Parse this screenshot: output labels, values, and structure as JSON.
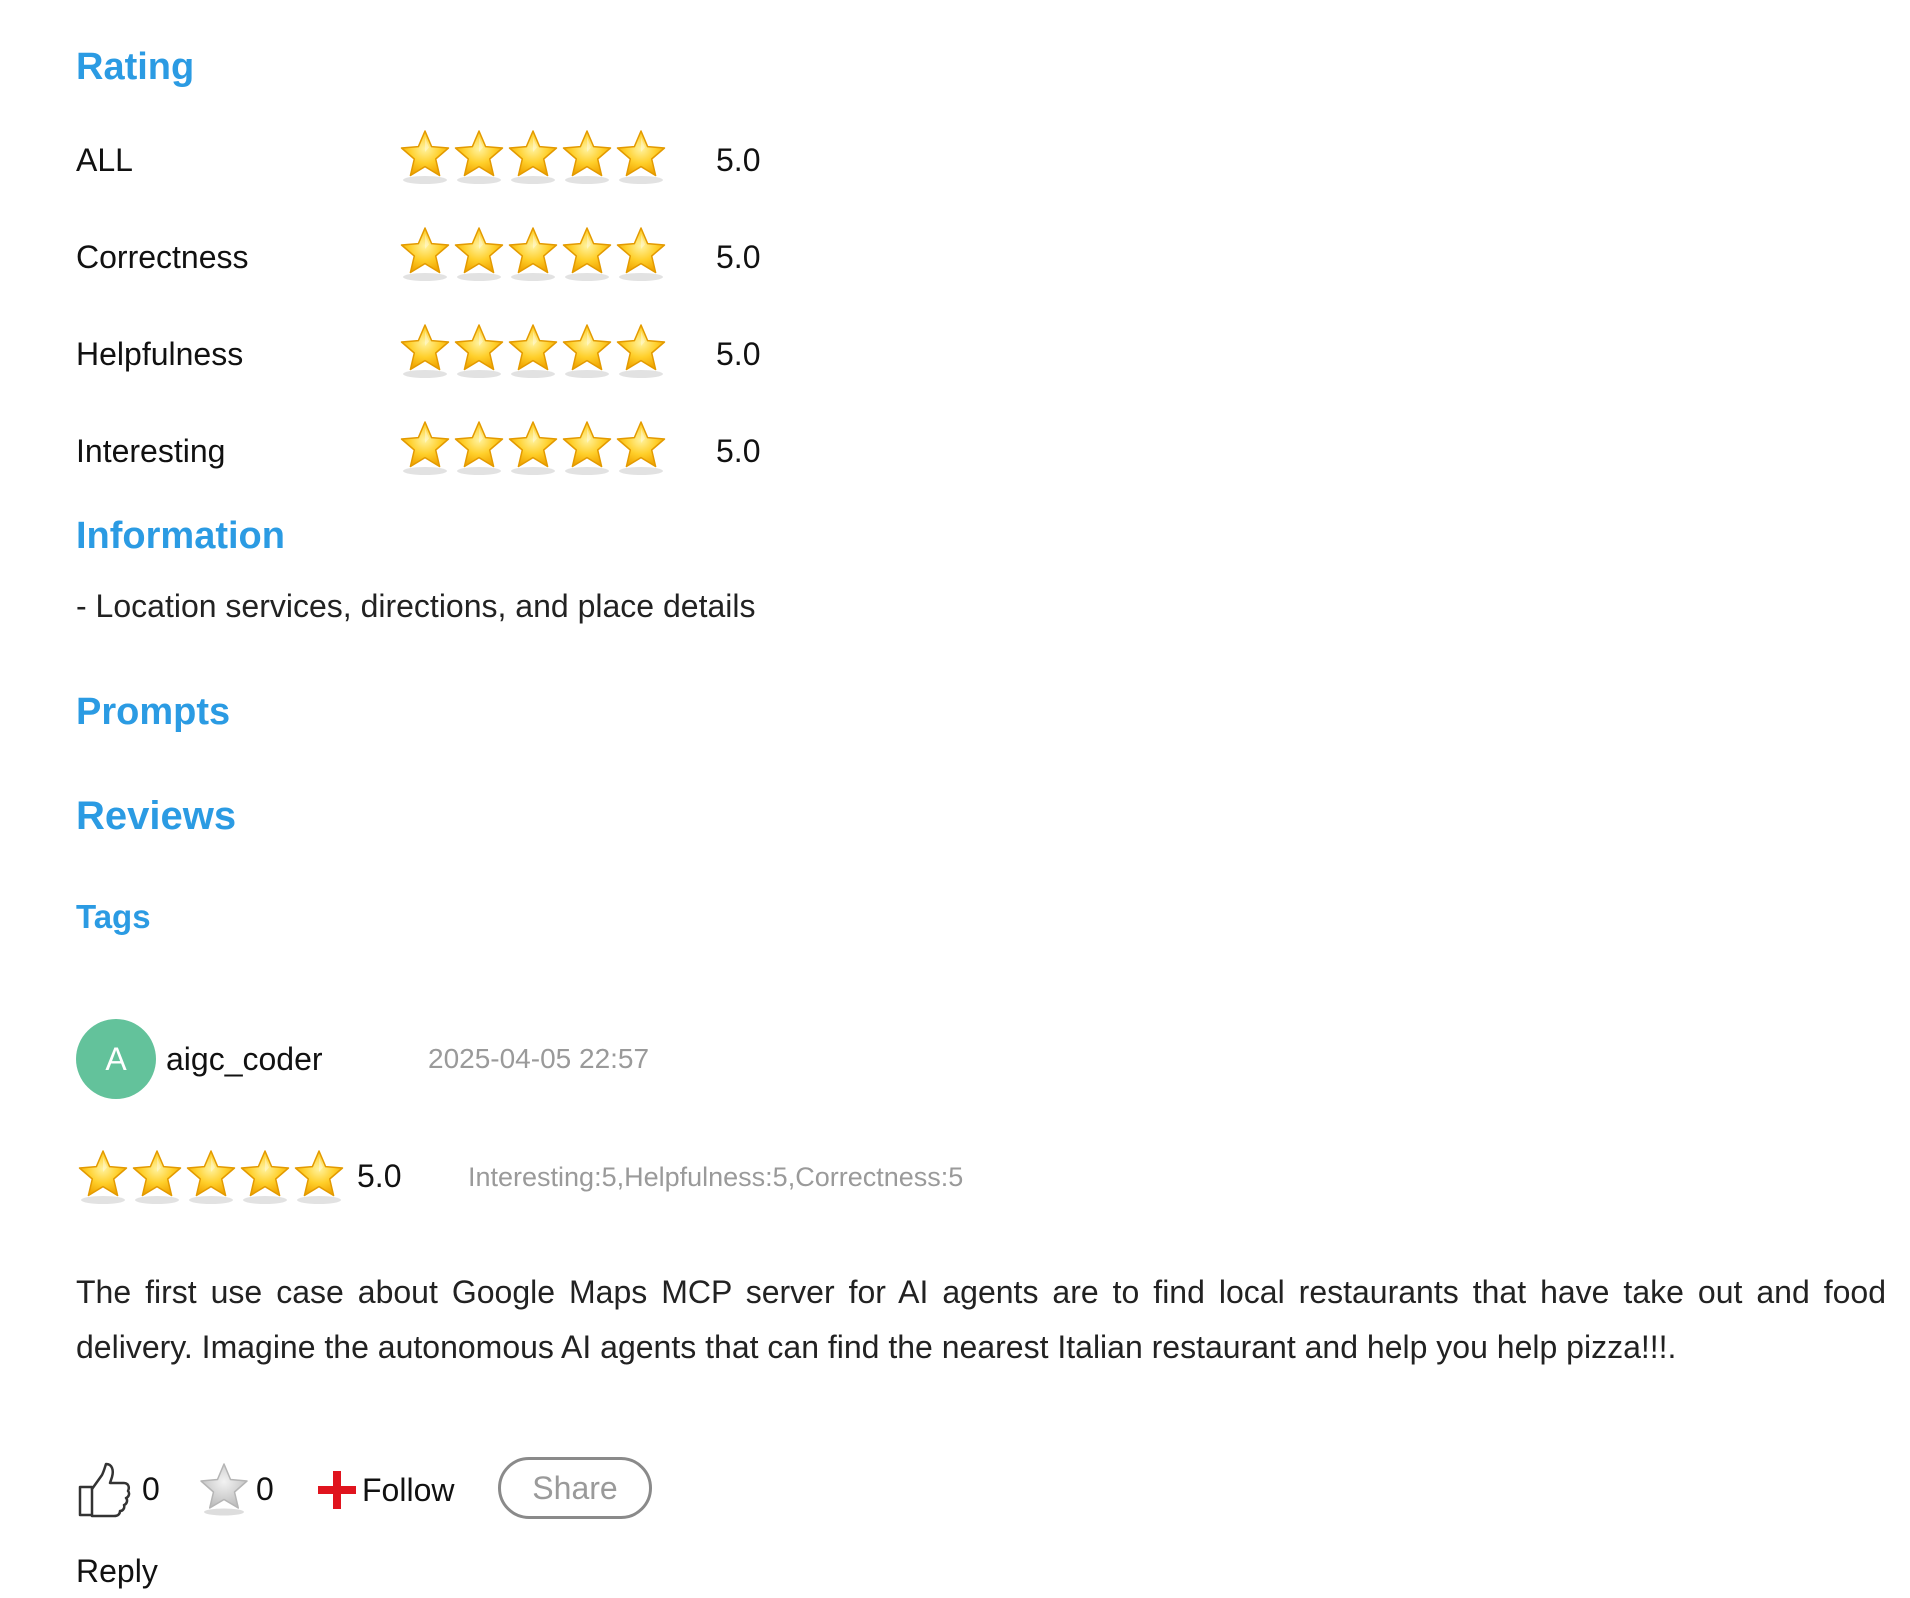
{
  "sections": {
    "rating": "Rating",
    "information": "Information",
    "prompts": "Prompts",
    "reviews": "Reviews",
    "tags": "Tags"
  },
  "ratings": [
    {
      "label": "ALL",
      "value": "5.0",
      "stars": 5
    },
    {
      "label": "Correctness",
      "value": "5.0",
      "stars": 5
    },
    {
      "label": "Helpfulness",
      "value": "5.0",
      "stars": 5
    },
    {
      "label": "Interesting",
      "value": "5.0",
      "stars": 5
    }
  ],
  "information": {
    "text": "- Location services, directions, and place details"
  },
  "review": {
    "avatar_letter": "A",
    "username": "aigc_coder",
    "date": "2025-04-05 22:57",
    "stars": 5,
    "score": "5.0",
    "sub_scores": "Interesting:5,Helpfulness:5,Correctness:5",
    "body": "The first use case about Google Maps MCP server for AI agents are to find local restaurants that have take out and food delivery. Imagine the autonomous AI agents that can find the nearest Italian restaurant and help you help pizza!!!.",
    "like_count": "0",
    "favorite_count": "0",
    "follow_label": "Follow",
    "share_label": "Share",
    "reply_label": "Reply"
  },
  "colors": {
    "heading": "#2b9be3",
    "avatar": "#63c29b",
    "star": "#ffc21a",
    "muted": "#9a9a9a",
    "follow_plus": "#e0141e"
  },
  "icons": {
    "star": "star-icon",
    "like": "thumbs-up-icon",
    "favorite": "star-outline-icon",
    "follow": "plus-icon"
  }
}
